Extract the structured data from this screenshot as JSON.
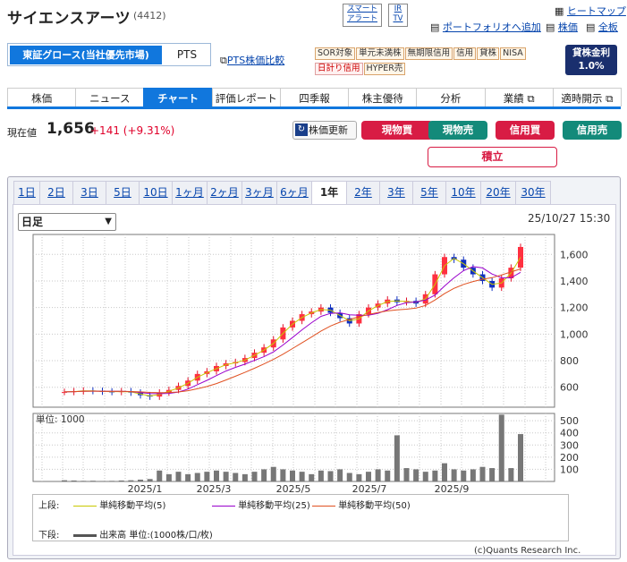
{
  "header": {
    "company": "サイエンスアーツ",
    "code": "(4412)",
    "smart_alert": [
      "スマート",
      "アラート"
    ],
    "ir": [
      "IR",
      "TV"
    ],
    "heatmap": "ヒートマップ",
    "portfolio_add": "ポートフォリオへ追加",
    "stock_price": "株価",
    "all_boards": "全板"
  },
  "market": {
    "active": "東証グロース(当社優先市場)",
    "pts": "PTS",
    "pts_compare": "PTS株価比較"
  },
  "badges": [
    "SOR対象",
    "単元未満株",
    "無期限信用",
    "信用",
    "貸株",
    "NISA",
    "日計り信用",
    "HYPER売"
  ],
  "lending": {
    "label": "貸株金利",
    "rate": "1.0%"
  },
  "nav": [
    "株価",
    "ニュース",
    "チャート",
    "評価レポート",
    "四季報",
    "株主優待",
    "分析",
    "業績",
    "適時開示"
  ],
  "nav_active": 2,
  "price": {
    "label": "現在値",
    "value": "1,656",
    "change": "+141 (+9.31%)",
    "refresh": "株価更新"
  },
  "trade_buttons": {
    "cash_buy": "現物買",
    "cash_sell": "現物売",
    "margin_buy": "信用買",
    "margin_sell": "信用売",
    "accumulate": "積立"
  },
  "ranges": [
    "1日",
    "2日",
    "3日",
    "5日",
    "10日",
    "1ヶ月",
    "2ヶ月",
    "3ヶ月",
    "6ヶ月",
    "1年",
    "2年",
    "3年",
    "5年",
    "10年",
    "20年",
    "30年"
  ],
  "range_active": 9,
  "chart_controls": {
    "interval": "日足",
    "timestamp": "25/10/27 15:30"
  },
  "chart_data": {
    "type": "line",
    "price_axis_ticks": [
      "1,600",
      "1,400",
      "1,200",
      "1,000",
      "800",
      "600"
    ],
    "price_axis_values": [
      1600,
      1400,
      1200,
      1000,
      800,
      600
    ],
    "volume_unit": "単位: 1000",
    "volume_axis_ticks": [
      "500",
      "400",
      "300",
      "200",
      "100"
    ],
    "volume_axis_values": [
      500,
      400,
      300,
      200,
      100
    ],
    "x_labels": [
      "2025/1",
      "2025/3",
      "2025/5",
      "2025/7",
      "2025/9"
    ],
    "price_points": [
      565,
      570,
      575,
      572,
      568,
      565,
      570,
      560,
      540,
      530,
      560,
      580,
      610,
      650,
      700,
      720,
      760,
      780,
      790,
      820,
      860,
      900,
      960,
      1050,
      1100,
      1150,
      1170,
      1200,
      1160,
      1120,
      1080,
      1150,
      1200,
      1230,
      1260,
      1240,
      1250,
      1230,
      1300,
      1450,
      1580,
      1560,
      1500,
      1450,
      1400,
      1350,
      1420,
      1500,
      1656
    ],
    "series": [
      {
        "name": "単純移動平均(5)",
        "color": "#c8c800"
      },
      {
        "name": "単純移動平均(25)",
        "color": "#9900cc"
      },
      {
        "name": "単純移動平均(50)",
        "color": "#e05020"
      }
    ],
    "volume_points": [
      10,
      8,
      5,
      6,
      4,
      5,
      8,
      10,
      15,
      20,
      90,
      60,
      80,
      60,
      70,
      80,
      90,
      80,
      70,
      60,
      80,
      100,
      120,
      100,
      90,
      80,
      60,
      90,
      85,
      100,
      70,
      60,
      80,
      100,
      90,
      380,
      110,
      100,
      80,
      90,
      150,
      100,
      90,
      100,
      120,
      110,
      550,
      110,
      390
    ],
    "lower_label": "下段:",
    "lower_legend": "出来高 単位:(1000株/口/枚)",
    "upper_label": "上段:"
  },
  "copyright": "(c)Quants Research Inc."
}
